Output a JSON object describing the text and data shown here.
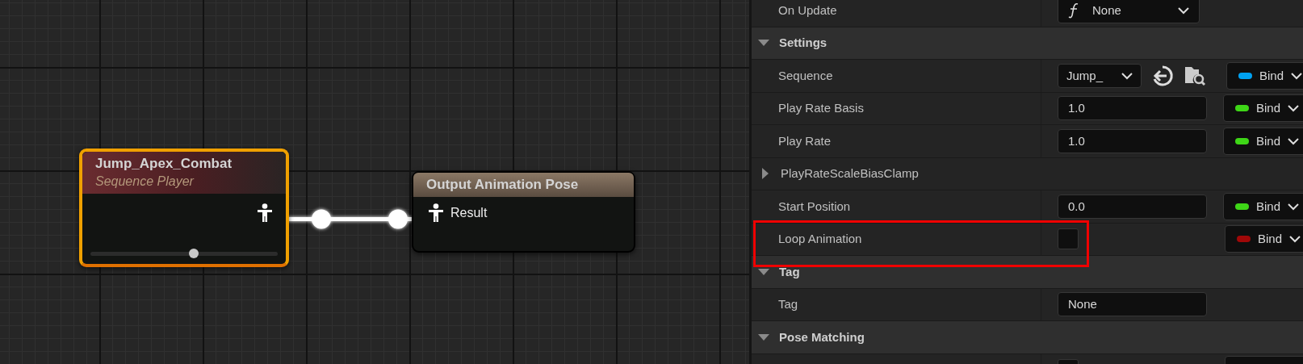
{
  "graph": {
    "nodes": [
      {
        "kind": "sequence",
        "title": "Jump_Apex_Combat",
        "subtitle": "Sequence Player",
        "selected": true,
        "level": 0.55
      },
      {
        "kind": "output",
        "title": "Output Animation Pose",
        "pin_label": "Result",
        "selected": false
      }
    ]
  },
  "details": {
    "rows": [
      {
        "kind": "property",
        "label": "On Update",
        "value": {
          "kind": "function",
          "text": "None"
        }
      },
      {
        "kind": "section",
        "label": "Settings",
        "expanded": true
      },
      {
        "kind": "property",
        "label": "Sequence",
        "value": {
          "kind": "asset",
          "text": "Jump_"
        },
        "bind": {
          "text": "Bind",
          "color": "#00a2f2"
        }
      },
      {
        "kind": "property",
        "label": "Play Rate Basis",
        "value": {
          "kind": "number",
          "text": "1.0"
        },
        "bind": {
          "text": "Bind",
          "color": "#3ed617"
        }
      },
      {
        "kind": "property",
        "label": "Play Rate",
        "value": {
          "kind": "number",
          "text": "1.0"
        },
        "bind": {
          "text": "Bind",
          "color": "#3ed617"
        }
      },
      {
        "kind": "struct",
        "label": "PlayRateScaleBiasClamp",
        "expanded": false
      },
      {
        "kind": "property",
        "label": "Start Position",
        "value": {
          "kind": "number",
          "text": "0.0"
        },
        "bind": {
          "text": "Bind",
          "color": "#3ed617"
        }
      },
      {
        "kind": "property",
        "label": "Loop Animation",
        "value": {
          "kind": "checkbox",
          "checked": false
        },
        "bind": {
          "text": "Bind",
          "color": "#a00808"
        },
        "highlighted": true
      },
      {
        "kind": "section",
        "label": "Tag",
        "expanded": true
      },
      {
        "kind": "property",
        "label": "Tag",
        "value": {
          "kind": "name",
          "text": "None"
        }
      },
      {
        "kind": "section",
        "label": "Pose Matching",
        "expanded": true
      },
      {
        "kind": "property",
        "value": {
          "kind": "checkbox",
          "checked": false
        },
        "bind": {}
      }
    ]
  }
}
